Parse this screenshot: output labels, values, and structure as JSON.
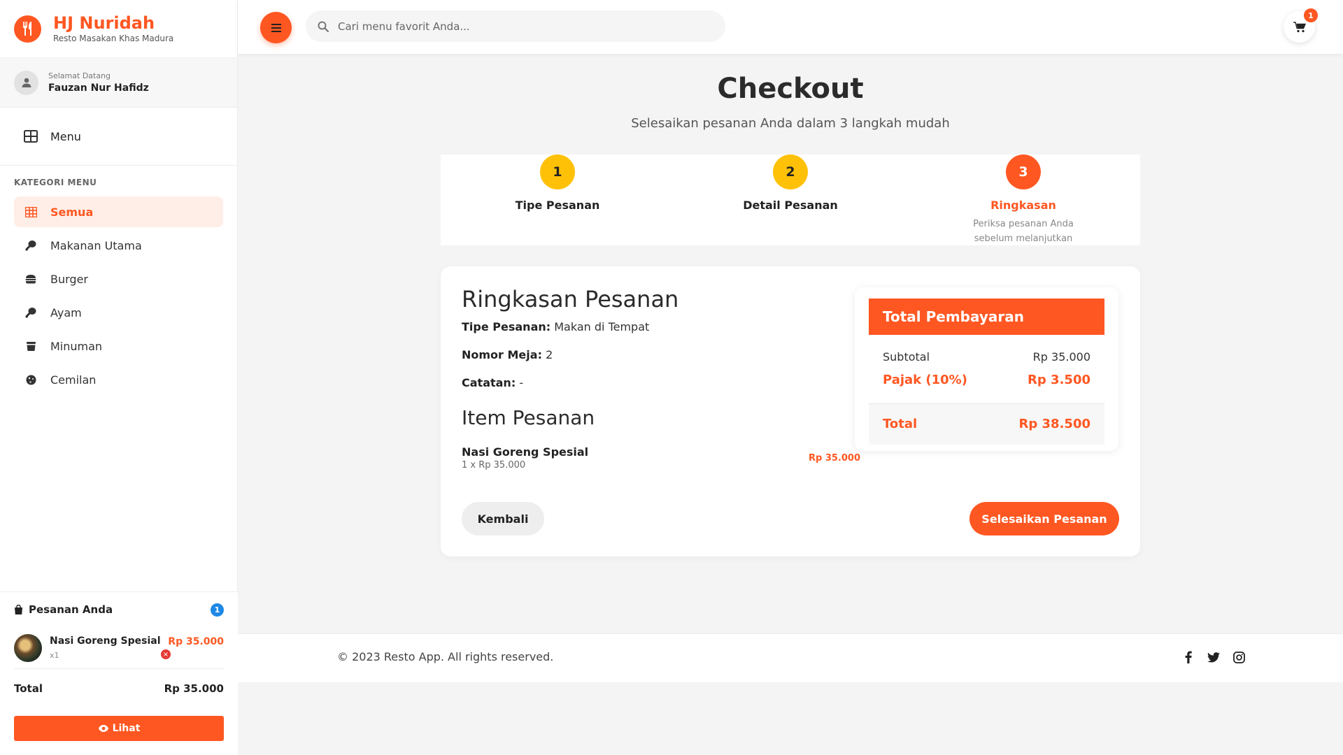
{
  "brand": {
    "name": "HJ Nuridah",
    "tagline": "Resto Masakan Khas Madura",
    "accent": "#ff5722"
  },
  "user": {
    "greeting": "Selamat Datang",
    "name": "Fauzan Nur Hafidz"
  },
  "nav": {
    "menu_label": "Menu"
  },
  "categories": {
    "title": "KATEGORI MENU",
    "items": [
      {
        "label": "Semua",
        "icon": "grid-icon",
        "active": true
      },
      {
        "label": "Makanan Utama",
        "icon": "drumstick-icon"
      },
      {
        "label": "Burger",
        "icon": "burger-icon"
      },
      {
        "label": "Ayam",
        "icon": "drumstick-icon"
      },
      {
        "label": "Minuman",
        "icon": "cup-icon"
      },
      {
        "label": "Cemilan",
        "icon": "cookie-icon"
      }
    ]
  },
  "orders": {
    "title": "Pesanan Anda",
    "count": "1",
    "items": [
      {
        "name": "Nasi Goreng Spesial",
        "qty": "x1",
        "price": "Rp 35.000"
      }
    ],
    "total_label": "Total",
    "total_value": "Rp 35.000",
    "view_label": "Lihat"
  },
  "search": {
    "placeholder": "Cari menu favorit Anda..."
  },
  "cart": {
    "count": "1"
  },
  "checkout": {
    "title": "Checkout",
    "subtitle": "Selesaikan pesanan Anda dalam 3 langkah mudah",
    "steps": [
      {
        "number": "1",
        "label": "Tipe Pesanan",
        "state": "done"
      },
      {
        "number": "2",
        "label": "Detail Pesanan",
        "state": "done"
      },
      {
        "number": "3",
        "label": "Ringkasan",
        "description": "Periksa pesanan Anda sebelum melanjutkan",
        "state": "current"
      }
    ]
  },
  "summary": {
    "title": "Ringkasan Pesanan",
    "order_type_label": "Tipe Pesanan:",
    "order_type_value": "Makan di Tempat",
    "table_label": "Nomor Meja:",
    "table_value": "2",
    "notes_label": "Catatan:",
    "notes_value": "-",
    "items_title": "Item Pesanan",
    "items": [
      {
        "name": "Nasi Goreng Spesial",
        "detail": "1 x Rp 35.000",
        "price": "Rp 35.000"
      }
    ]
  },
  "payment": {
    "title": "Total Pembayaran",
    "subtotal_label": "Subtotal",
    "subtotal_value": "Rp 35.000",
    "tax_label": "Pajak (10%)",
    "tax_value": "Rp 3.500",
    "total_label": "Total",
    "total_value": "Rp 38.500"
  },
  "actions": {
    "back_label": "Kembali",
    "finish_label": "Selesaikan Pesanan"
  },
  "footer": {
    "copyright": "© 2023 Resto App. All rights reserved.",
    "socials": [
      "facebook-icon",
      "twitter-icon",
      "instagram-icon"
    ]
  }
}
